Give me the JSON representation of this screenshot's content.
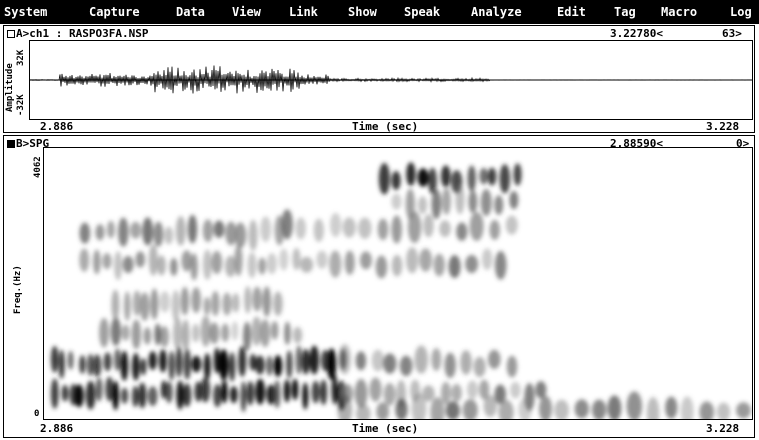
{
  "menu": [
    "System",
    "Capture",
    "Data",
    "View",
    "Link",
    "Show",
    "Speak",
    "Analyze",
    "Edit",
    "Tag",
    "Macro",
    "Log"
  ],
  "panelA": {
    "title": "A>ch1 : RASPO3FA.NSP",
    "cursor_time": "3.22780<",
    "cursor_value": "63>",
    "y_label": "Amplitude",
    "y_max": "32K",
    "y_min": "-32K",
    "x_start": "2.886",
    "x_label": "Time (sec)",
    "x_end": "3.228"
  },
  "panelB": {
    "title": "B>SPG",
    "cursor_time": "2.88590<",
    "cursor_value": "0>",
    "y_label": "Freq.(Hz)",
    "y_max": "4062",
    "y_min": "0",
    "x_start": "2.886",
    "x_label": "Time (sec)",
    "x_end": "3.228"
  },
  "colors": {
    "menu_bg": "#000000",
    "menu_fg": "#ffffff",
    "ink": "#000000",
    "paper": "#ffffff"
  }
}
